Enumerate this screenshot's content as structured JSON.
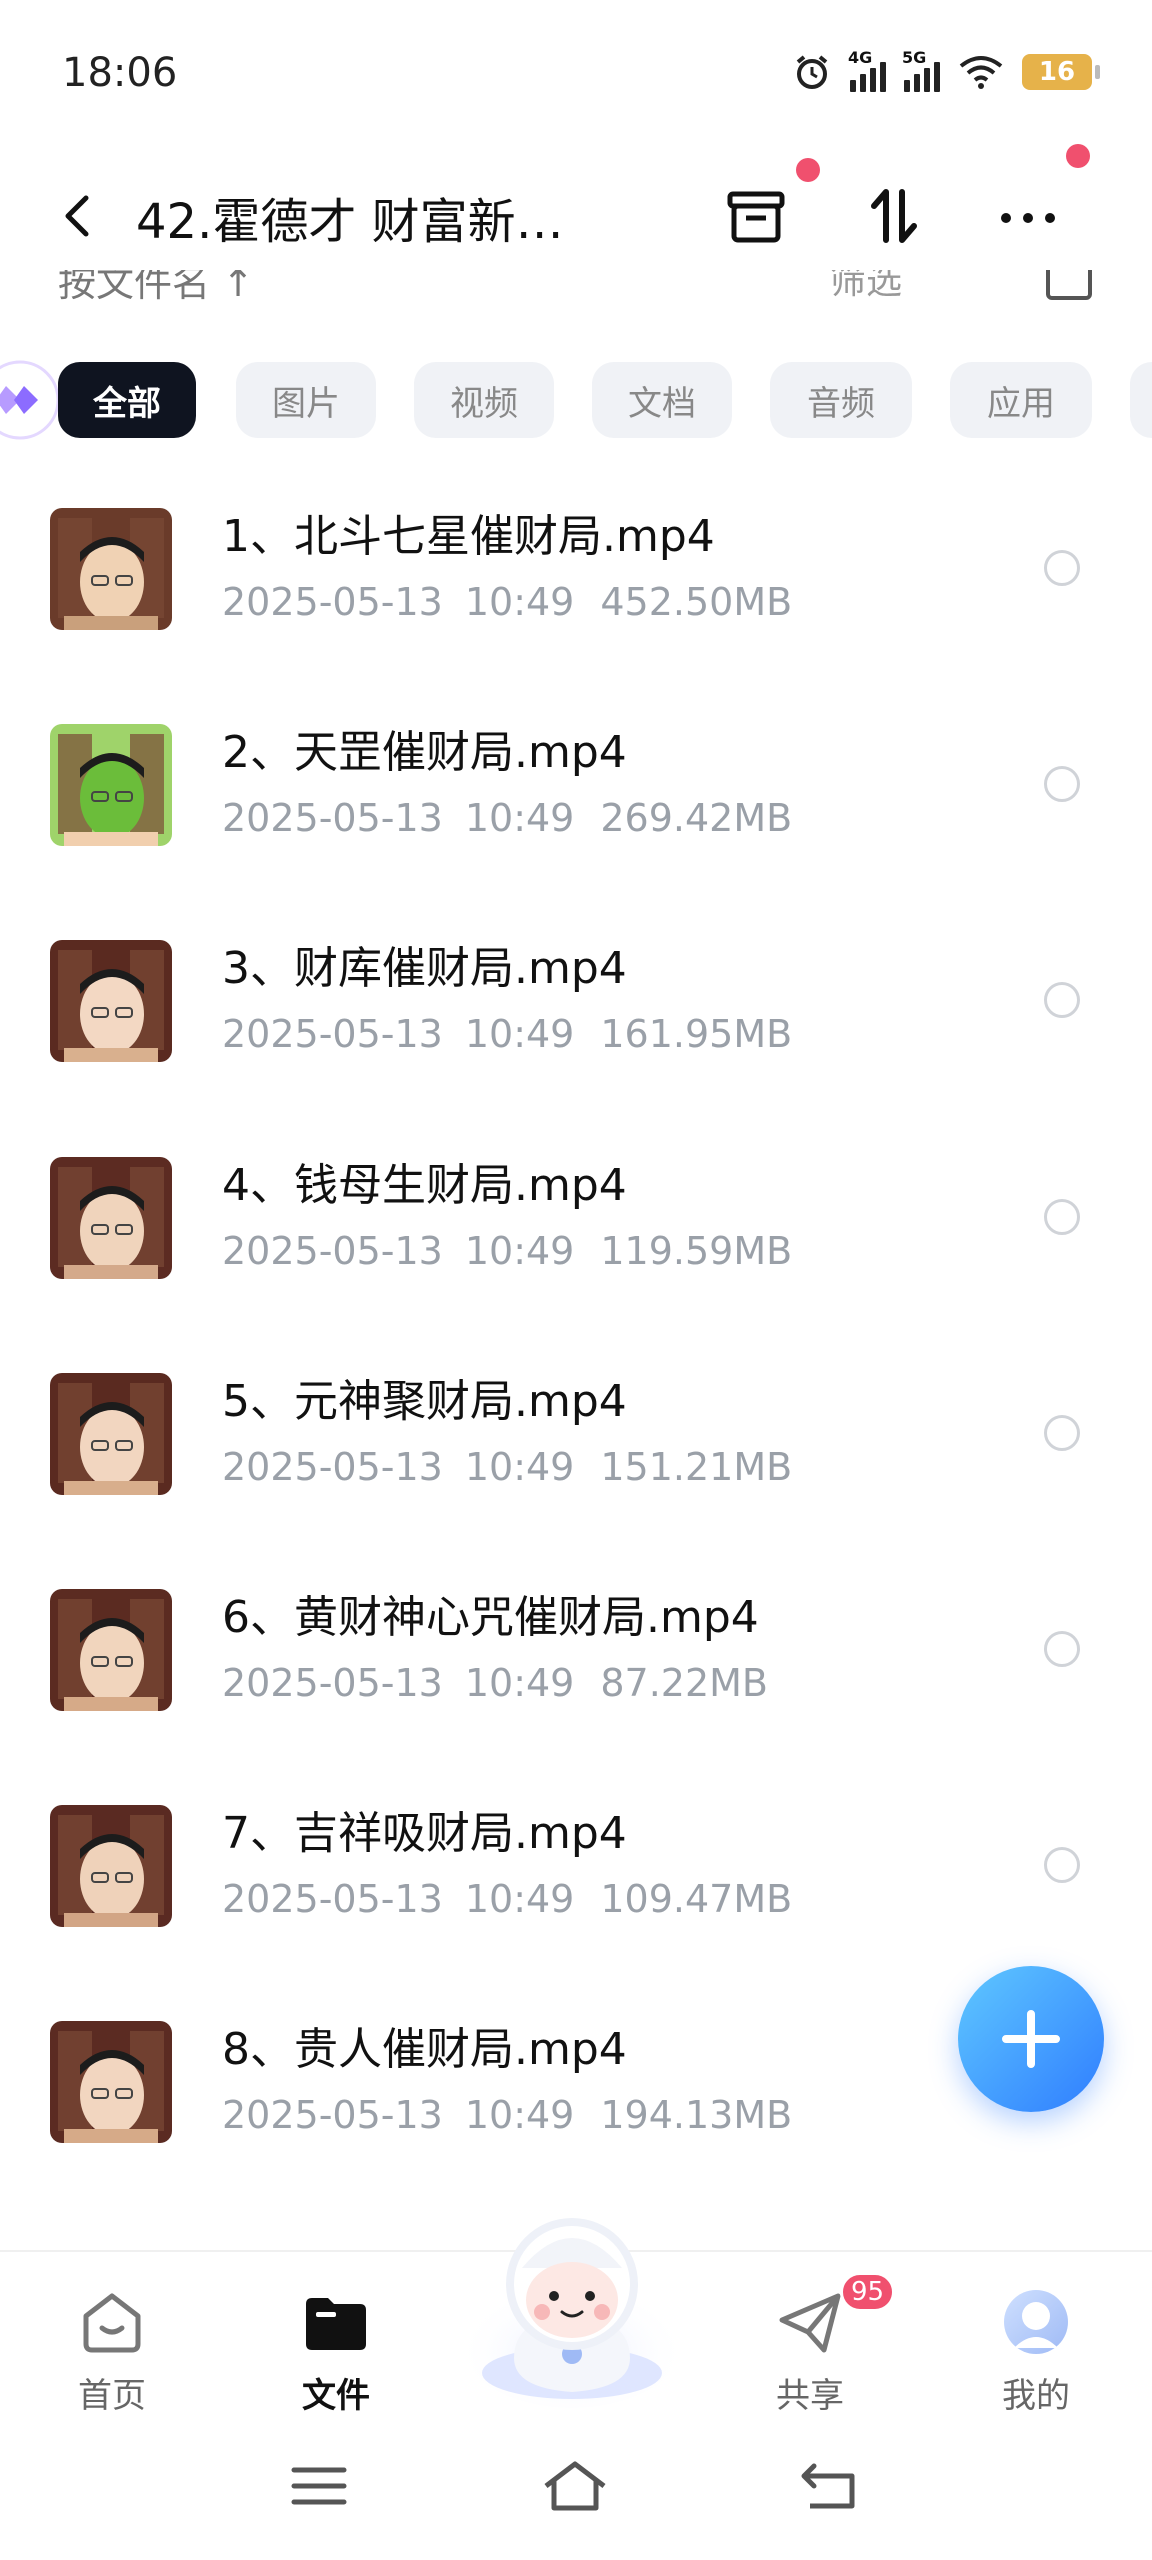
{
  "status_bar": {
    "time": "18:06",
    "net1": "4G",
    "net2": "5G",
    "battery": "16"
  },
  "header": {
    "title": "42.霍德才 财富新…"
  },
  "sub_bar": {
    "sort_label": "按文件名 ↑",
    "filter_label": "筛选"
  },
  "filters": [
    {
      "label": "全部",
      "active": true
    },
    {
      "label": "图片",
      "active": false
    },
    {
      "label": "视频",
      "active": false
    },
    {
      "label": "文档",
      "active": false
    },
    {
      "label": "音频",
      "active": false
    },
    {
      "label": "应用",
      "active": false
    }
  ],
  "files": [
    {
      "name": "1、北斗七星催财局.mp4",
      "date": "2025-05-13",
      "time": "10:49",
      "size": "452.50MB"
    },
    {
      "name": "2、天罡催财局.mp4",
      "date": "2025-05-13",
      "time": "10:49",
      "size": "269.42MB"
    },
    {
      "name": "3、财库催财局.mp4",
      "date": "2025-05-13",
      "time": "10:49",
      "size": "161.95MB"
    },
    {
      "name": "4、钱母生财局.mp4",
      "date": "2025-05-13",
      "time": "10:49",
      "size": "119.59MB"
    },
    {
      "name": "5、元神聚财局.mp4",
      "date": "2025-05-13",
      "time": "10:49",
      "size": "151.21MB"
    },
    {
      "name": "6、黄财神心咒催财局.mp4",
      "date": "2025-05-13",
      "time": "10:49",
      "size": "87.22MB"
    },
    {
      "name": "7、吉祥吸财局.mp4",
      "date": "2025-05-13",
      "time": "10:49",
      "size": "109.47MB"
    },
    {
      "name": "8、贵人催财局.mp4",
      "date": "2025-05-13",
      "time": "10:49",
      "size": "194.13MB"
    }
  ],
  "bottom_nav": [
    {
      "label": "首页",
      "icon": "home-icon",
      "active": false
    },
    {
      "label": "文件",
      "icon": "folder-icon",
      "active": true
    },
    {
      "label": "共享",
      "icon": "share-icon",
      "active": false,
      "badge": "95"
    },
    {
      "label": "我的",
      "icon": "profile-icon",
      "active": false
    }
  ],
  "colors": {
    "accent": "#2f7dff",
    "badge": "#f0506e",
    "chip_active": "#0f1420"
  }
}
